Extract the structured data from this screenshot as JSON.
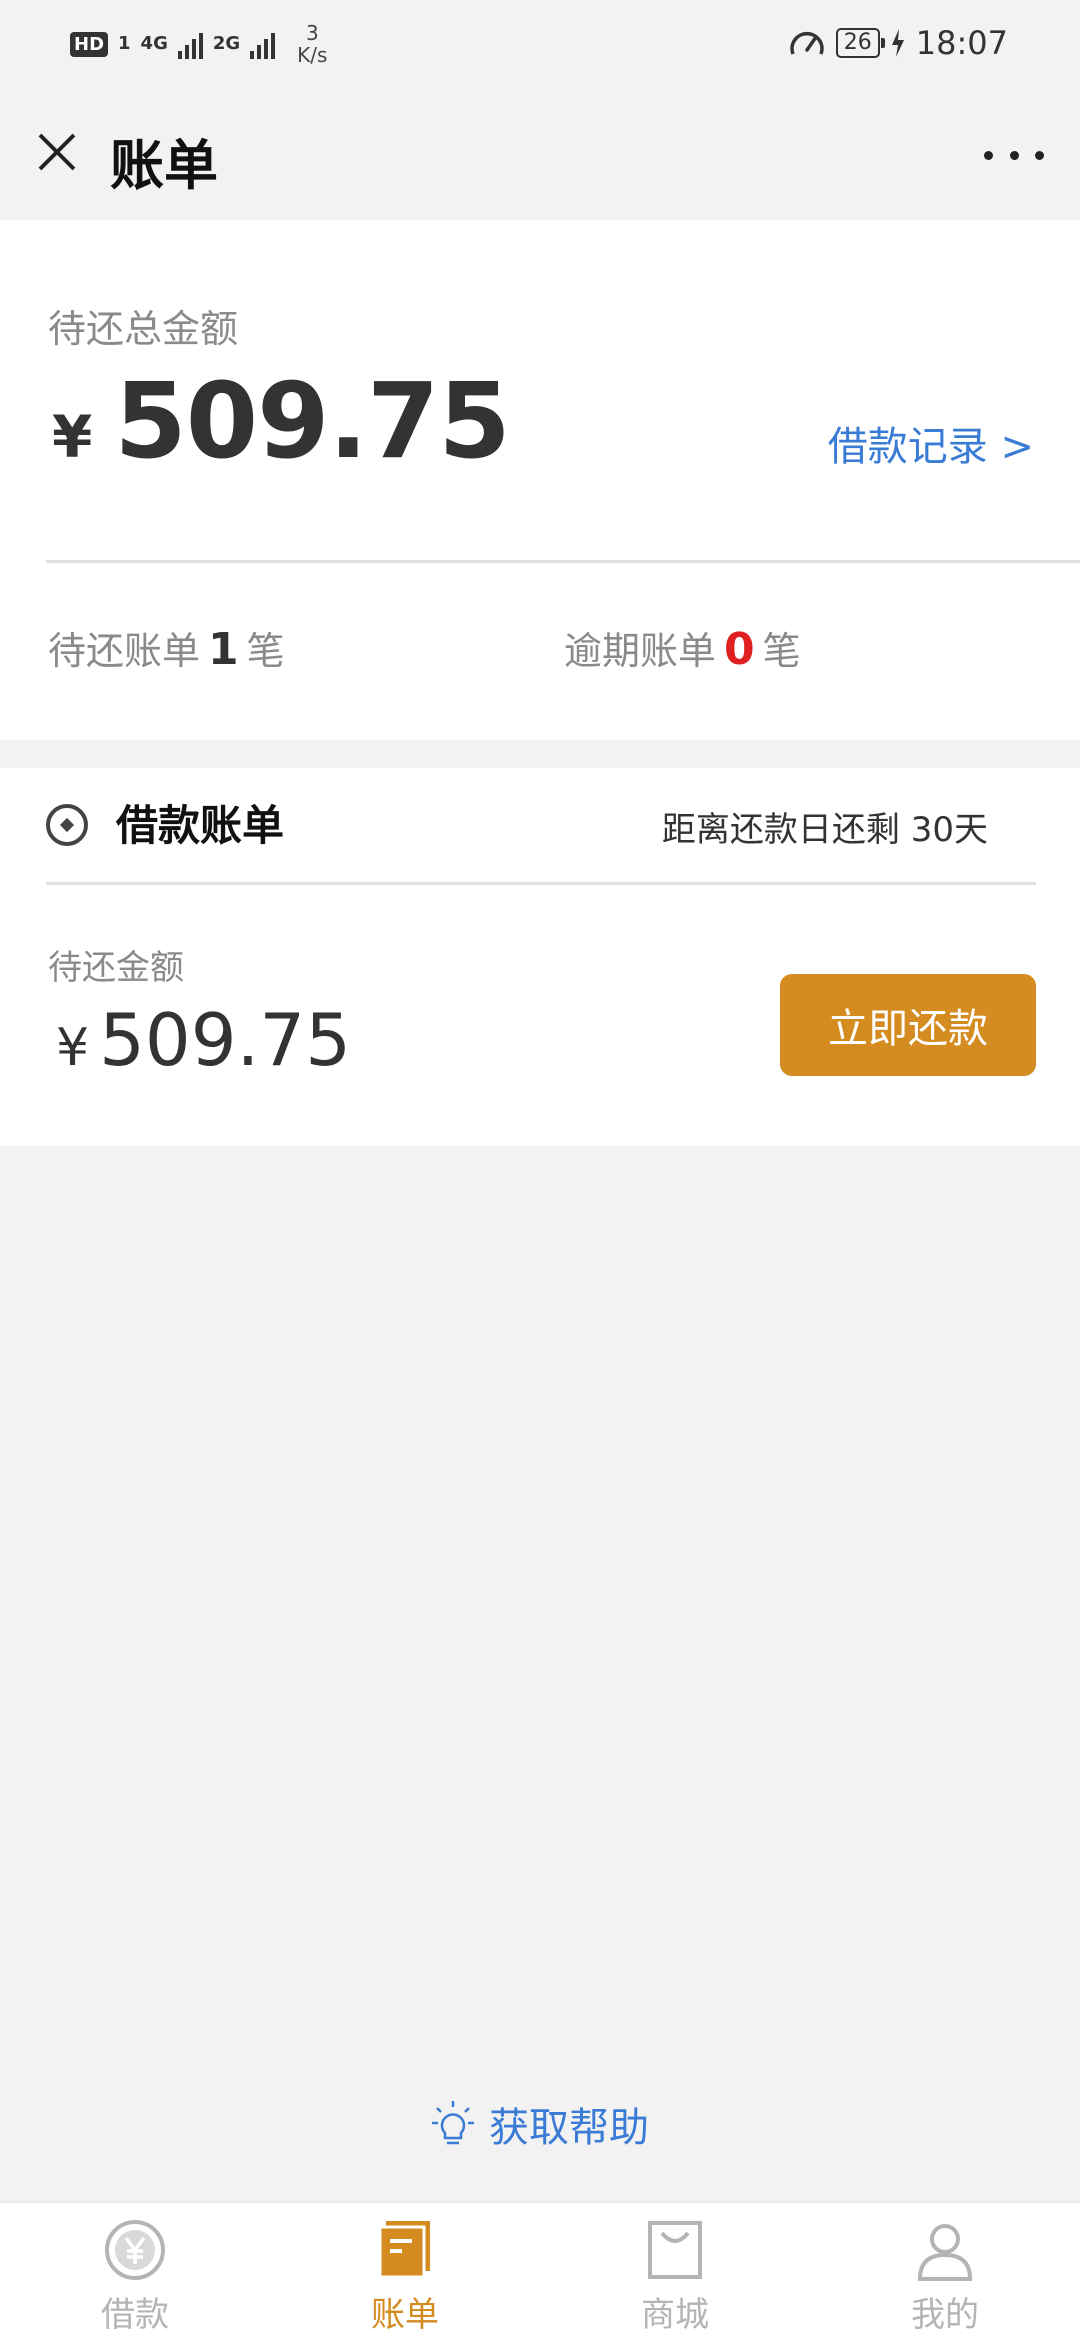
{
  "status_bar": {
    "hd_badge": "HD",
    "sim1": "1",
    "net1": "4G",
    "net2": "2G",
    "speed_value": "3",
    "speed_unit": "K/s",
    "battery": "26",
    "time": "18:07"
  },
  "header": {
    "title": "账单"
  },
  "summary": {
    "label": "待还总金额",
    "currency": "¥",
    "amount": "509.75",
    "loan_record_link": "借款记录 >",
    "pending_label": "待还账单",
    "pending_count": "1",
    "pending_unit": "笔",
    "overdue_label": "逾期账单",
    "overdue_count": "0",
    "overdue_unit": "笔"
  },
  "bill": {
    "title": "借款账单",
    "countdown": "距离还款日还剩 30天",
    "amount_label": "待还金额",
    "currency": "¥",
    "amount": "509.75",
    "repay_button": "立即还款"
  },
  "help": {
    "label": "获取帮助"
  },
  "tabs": [
    {
      "label": "借款",
      "icon": "yen-coin-icon",
      "active": false
    },
    {
      "label": "账单",
      "icon": "bill-icon",
      "active": true
    },
    {
      "label": "商城",
      "icon": "shopping-bag-icon",
      "active": false
    },
    {
      "label": "我的",
      "icon": "person-icon",
      "active": false
    }
  ],
  "colors": {
    "accent": "#d48b20",
    "link": "#3a7bd5",
    "overdue": "#e02020",
    "background": "#f2f2f2"
  }
}
